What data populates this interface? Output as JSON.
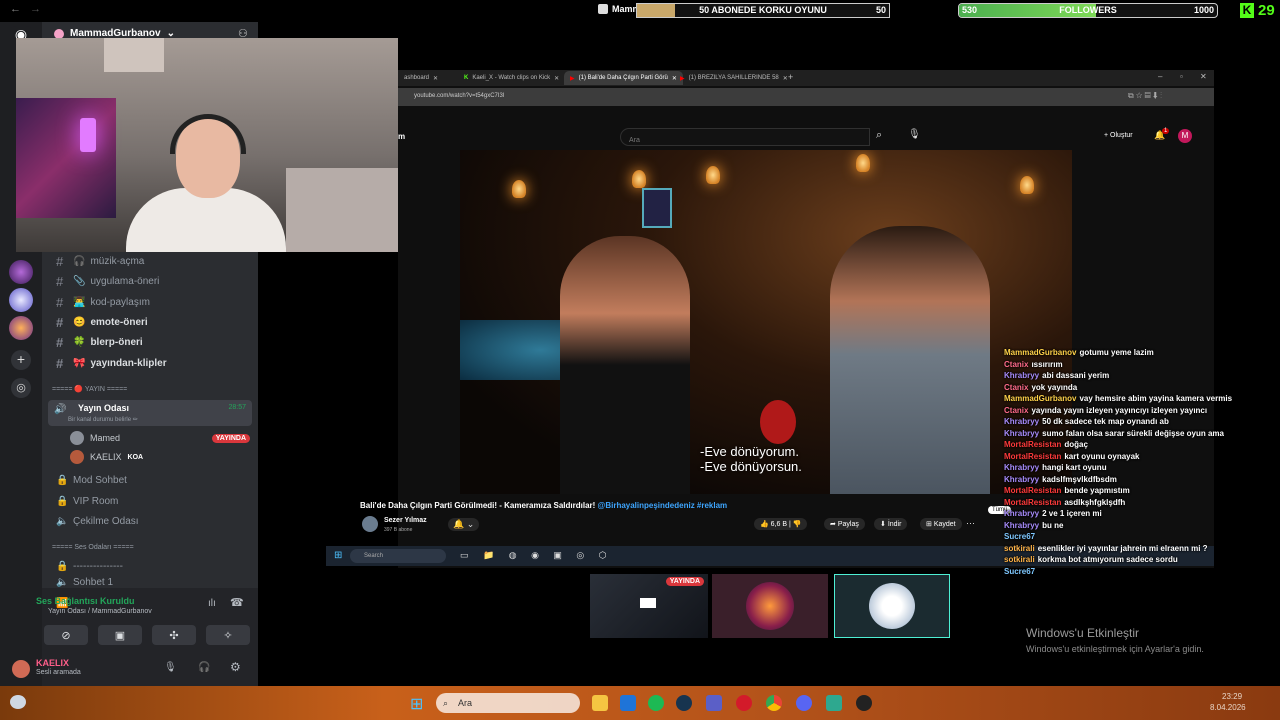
{
  "overlay": {
    "username": "MammadGurbanov",
    "goal_label": "50 ABONEDE KORKU OYUNU",
    "goal_target": "50",
    "goal_progress_fraction": 0.15,
    "followers_label": "FOLLOWERS",
    "followers_current": "530",
    "followers_target": "1000",
    "followers_progress_fraction": 0.53,
    "kick_count": "29"
  },
  "discord": {
    "user_header": "MammadGurbanov",
    "channels": [
      {
        "label": "müzik-açma",
        "emoji": "🎧"
      },
      {
        "label": "uygulama-öneri",
        "emoji": "📎"
      },
      {
        "label": "kod-paylaşım",
        "emoji": "👨‍💻"
      },
      {
        "label": "emote-öneri",
        "emoji": "😊"
      },
      {
        "label": "blerp-öneri",
        "emoji": "🍀"
      },
      {
        "label": "yayından-klipler",
        "emoji": "🎀"
      }
    ],
    "category_live": "===== 🔴 YAYIN =====",
    "voice_channel": "Yayın Odası",
    "voice_timer": "28:57",
    "voice_status": "Bir kanal durumu belirle ✏",
    "members": [
      {
        "name": "Mamed",
        "badge": "YAYINDA"
      },
      {
        "name": "KAELIX",
        "tag": "KOA"
      }
    ],
    "extra_channels": [
      "Mod Sohbet",
      "VIP Room",
      "Çekilme Odası"
    ],
    "category_voice": "===== Ses Odaları =====",
    "divider_channel": "---------------",
    "sohbet": "Sohbet 1",
    "connection_title": "Ses Bağlantısı Kuruldu",
    "connection_sub": "Yayın Odası / MammadGurbanov",
    "self_name": "KAELIX",
    "self_status": "Sesli aramada"
  },
  "browser": {
    "tabs": [
      "ashboard",
      "Kaeli_X - Watch clips on Kick",
      "(1) Bali'de Daha Çılgın Parti Görü",
      "(1) BREZILYA SAHILLERINDE 58"
    ],
    "url": "youtube.com/watch?v=t54gxC7I3I",
    "search_placeholder": "Ara",
    "create_label": "Oluştur",
    "avatar_letter": "M",
    "notif_count": "1",
    "subtitle_lines": [
      "-Eve dönüyorum.",
      "-Eve dönüyorsun."
    ],
    "video_title": "Bali'de Daha Çılgın Parti Görülmedi! - Kameramıza Saldırdılar!",
    "video_hashtags": "@Birhayalinpeşindedeniz #reklam",
    "channel_name": "Sezer Yılmaz",
    "channel_subs": "397 B abone",
    "likes": "6,6 B",
    "share_label": "Paylaş",
    "download_label": "İndir",
    "save_label": "Kaydet",
    "taskbar_search": "Search"
  },
  "chat": [
    {
      "nick": "MammadGurbanov",
      "msg": "gotumu yeme lazim",
      "color": "#ffd24a"
    },
    {
      "nick": "Ctanix",
      "msg": "ıssırırım",
      "color": "#ff6b8a"
    },
    {
      "nick": "Khrabryy",
      "msg": "abi dassani yerim",
      "color": "#a78bfa"
    },
    {
      "nick": "Ctanix",
      "msg": "yok yayında",
      "color": "#ff6b8a"
    },
    {
      "nick": "MammadGurbanov",
      "msg": "vay hemsire abim yayina kamera vermis",
      "color": "#ffd24a"
    },
    {
      "nick": "Ctanix",
      "msg": "yayında yayın izleyen yayıncıyı izleyen yayıncı",
      "color": "#ff6b8a"
    },
    {
      "nick": "Khrabryy",
      "msg": "50 dk sadece tek map oynandı ab",
      "color": "#a78bfa"
    },
    {
      "nick": "Khrabryy",
      "msg": "sumo falan olsa sarar sürekli değişse oyun ama",
      "color": "#a78bfa"
    },
    {
      "nick": "MortalResistan",
      "msg": "doğaç",
      "color": "#ff3b3b"
    },
    {
      "nick": "MortalResistan",
      "msg": "kart oyunu oynayak",
      "color": "#ff3b3b"
    },
    {
      "nick": "Khrabryy",
      "msg": "hangi kart oyunu",
      "color": "#a78bfa"
    },
    {
      "nick": "Khrabryy",
      "msg": "kadslfmşvlkdfbsdm",
      "color": "#a78bfa"
    },
    {
      "nick": "MortalResistan",
      "msg": "bende yapmıstım",
      "color": "#ff3b3b"
    },
    {
      "nick": "MortalResistan",
      "msg": "asdlkşhfgklşdfh",
      "color": "#ff3b3b"
    },
    {
      "nick": "Khrabryy",
      "msg": "2 ve 1 içeren mi",
      "color": "#a78bfa"
    },
    {
      "nick": "Khrabryy",
      "msg": "bu ne",
      "color": "#a78bfa"
    },
    {
      "nick": "Sucre67",
      "msg": "",
      "color": "#7fc8ff"
    },
    {
      "nick": "sotkirali",
      "msg": "esenlikler iyi yayınlar jahrein mi elraenn mi ?",
      "color": "#ffb347"
    },
    {
      "nick": "sotkirali",
      "msg": "korkma bot atmıyorum sadece sordu",
      "color": "#ffb347"
    },
    {
      "nick": "Sucre67",
      "msg": "",
      "color": "#7fc8ff"
    }
  ],
  "clip_live_badge": "YAYINDA",
  "activation": {
    "title": "Windows'u Etkinleştir",
    "subtitle": "Windows'u etkinleştirmek için Ayarlar'a gidin."
  },
  "taskbar": {
    "search_placeholder": "Ara",
    "time": "23:29",
    "date": "8.04.2026"
  }
}
